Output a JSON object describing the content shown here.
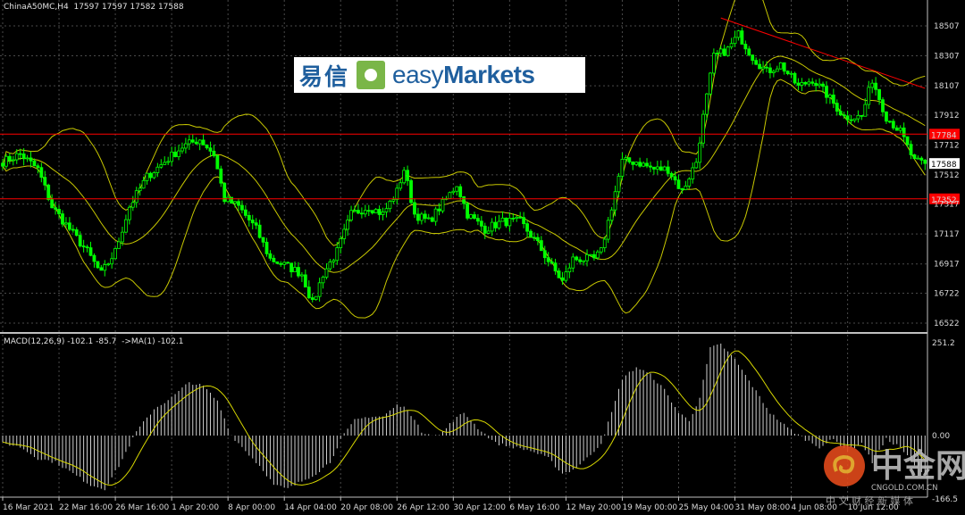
{
  "header": {
    "symbol": "ChinaA50MC,H4",
    "ohlc": "17597 17597 17582 17588"
  },
  "macd_header": {
    "label": "MACD(12,26,9)",
    "values": "-102.1 -85.7",
    "ma": "->MA(1) -102.1"
  },
  "logo": {
    "cn": "易信",
    "en_light": "easy",
    "en_bold": "Markets"
  },
  "watermark": {
    "cn": "中金网",
    "domain": "CNGOLD.COM.CN",
    "slogan": "中 文 财 经 新 媒 体"
  },
  "colors": {
    "bull": "#00ff00",
    "band": "#c8c800",
    "level": "#ff0000",
    "grid": "#4a4a4a",
    "hist": "#d0d0d0",
    "signal": "#d8d800"
  },
  "chart_data": [
    {
      "type": "candlestick",
      "title": "ChinaA50MC,H4",
      "ylim": [
        16440,
        18620
      ],
      "yticks": [
        18507,
        18307,
        18107,
        17912,
        17712,
        17512,
        17317,
        17117,
        16917,
        16722,
        16522
      ],
      "current_price": 17588,
      "levels": [
        17784,
        17352
      ],
      "trendline": [
        [
          204,
          18560
        ],
        [
          262,
          18090
        ]
      ],
      "bars": 263,
      "xticks": [
        {
          "bar": 0,
          "label": "16 Mar 2021"
        },
        {
          "bar": 16,
          "label": "22 Mar 16:00"
        },
        {
          "bar": 32,
          "label": "26 Mar 16:00"
        },
        {
          "bar": 48,
          "label": "1 Apr 20:00"
        },
        {
          "bar": 64,
          "label": "8 Apr 00:00"
        },
        {
          "bar": 80,
          "label": "14 Apr 04:00"
        },
        {
          "bar": 96,
          "label": "20 Apr 08:00"
        },
        {
          "bar": 112,
          "label": "26 Apr 12:00"
        },
        {
          "bar": 128,
          "label": "30 Apr 12:00"
        },
        {
          "bar": 144,
          "label": "6 May 16:00"
        },
        {
          "bar": 160,
          "label": "12 May 20:00"
        },
        {
          "bar": 176,
          "label": "19 May 00:00"
        },
        {
          "bar": 192,
          "label": "25 May 04:00"
        },
        {
          "bar": 208,
          "label": "31 May 08:00"
        },
        {
          "bar": 224,
          "label": "4 Jun 08:00"
        },
        {
          "bar": 240,
          "label": "10 Jun 12:00"
        }
      ],
      "close_anchors": [
        [
          0,
          17600
        ],
        [
          5,
          17650
        ],
        [
          10,
          17550
        ],
        [
          14,
          17300
        ],
        [
          19,
          17150
        ],
        [
          24,
          17000
        ],
        [
          28,
          16850
        ],
        [
          32,
          17000
        ],
        [
          36,
          17300
        ],
        [
          41,
          17500
        ],
        [
          46,
          17600
        ],
        [
          51,
          17700
        ],
        [
          56,
          17750
        ],
        [
          60,
          17650
        ],
        [
          63,
          17350
        ],
        [
          67,
          17300
        ],
        [
          72,
          17150
        ],
        [
          76,
          16950
        ],
        [
          81,
          16900
        ],
        [
          85,
          16850
        ],
        [
          88,
          16650
        ],
        [
          91,
          16850
        ],
        [
          95,
          17000
        ],
        [
          99,
          17250
        ],
        [
          104,
          17300
        ],
        [
          108,
          17250
        ],
        [
          112,
          17400
        ],
        [
          114,
          17550
        ],
        [
          117,
          17250
        ],
        [
          121,
          17200
        ],
        [
          126,
          17350
        ],
        [
          129,
          17450
        ],
        [
          132,
          17250
        ],
        [
          137,
          17150
        ],
        [
          142,
          17200
        ],
        [
          147,
          17200
        ],
        [
          152,
          17050
        ],
        [
          156,
          16900
        ],
        [
          159,
          16800
        ],
        [
          162,
          16950
        ],
        [
          168,
          16950
        ],
        [
          170,
          17000
        ],
        [
          173,
          17300
        ],
        [
          176,
          17600
        ],
        [
          180,
          17600
        ],
        [
          185,
          17550
        ],
        [
          189,
          17550
        ],
        [
          193,
          17400
        ],
        [
          197,
          17600
        ],
        [
          199,
          17900
        ],
        [
          202,
          18300
        ],
        [
          206,
          18350
        ],
        [
          209,
          18450
        ],
        [
          213,
          18300
        ],
        [
          217,
          18200
        ],
        [
          221,
          18250
        ],
        [
          226,
          18100
        ],
        [
          230,
          18150
        ],
        [
          234,
          18050
        ],
        [
          239,
          17900
        ],
        [
          244,
          17900
        ],
        [
          247,
          18150
        ],
        [
          251,
          17900
        ],
        [
          255,
          17800
        ],
        [
          259,
          17600
        ],
        [
          262,
          17588
        ]
      ],
      "indicator": "Bollinger Bands (20, 2)"
    },
    {
      "type": "bar",
      "title": "MACD(12,26,9)",
      "ylim": [
        -166.5,
        251.2
      ],
      "yticks": [
        251.2,
        0.0,
        -166.5
      ],
      "ytick_labels": [
        "251.2",
        "0.00",
        "-166.5"
      ],
      "macd_anchors": [
        [
          0,
          -20
        ],
        [
          5,
          -30
        ],
        [
          10,
          -60
        ],
        [
          15,
          -70
        ],
        [
          20,
          -100
        ],
        [
          25,
          -130
        ],
        [
          29,
          -140
        ],
        [
          33,
          -80
        ],
        [
          38,
          10
        ],
        [
          43,
          70
        ],
        [
          48,
          100
        ],
        [
          53,
          140
        ],
        [
          57,
          130
        ],
        [
          61,
          90
        ],
        [
          65,
          0
        ],
        [
          69,
          -40
        ],
        [
          74,
          -90
        ],
        [
          77,
          -130
        ],
        [
          81,
          -140
        ],
        [
          85,
          -120
        ],
        [
          89,
          -100
        ],
        [
          93,
          -70
        ],
        [
          96,
          -10
        ],
        [
          100,
          40
        ],
        [
          104,
          50
        ],
        [
          108,
          50
        ],
        [
          112,
          80
        ],
        [
          115,
          70
        ],
        [
          119,
          10
        ],
        [
          124,
          0
        ],
        [
          128,
          40
        ],
        [
          131,
          60
        ],
        [
          135,
          20
        ],
        [
          140,
          -20
        ],
        [
          145,
          -30
        ],
        [
          150,
          -40
        ],
        [
          155,
          -60
        ],
        [
          159,
          -100
        ],
        [
          162,
          -90
        ],
        [
          166,
          -60
        ],
        [
          170,
          -20
        ],
        [
          173,
          60
        ],
        [
          176,
          150
        ],
        [
          180,
          180
        ],
        [
          184,
          160
        ],
        [
          188,
          120
        ],
        [
          192,
          60
        ],
        [
          195,
          40
        ],
        [
          198,
          100
        ],
        [
          201,
          230
        ],
        [
          204,
          240
        ],
        [
          208,
          200
        ],
        [
          213,
          130
        ],
        [
          218,
          60
        ],
        [
          223,
          20
        ],
        [
          228,
          -10
        ],
        [
          232,
          -30
        ],
        [
          236,
          -10
        ],
        [
          240,
          -40
        ],
        [
          244,
          -20
        ],
        [
          247,
          -70
        ],
        [
          251,
          -10
        ],
        [
          255,
          -30
        ],
        [
          259,
          -80
        ],
        [
          262,
          -102.1
        ]
      ],
      "signal_last": -85.7
    }
  ]
}
